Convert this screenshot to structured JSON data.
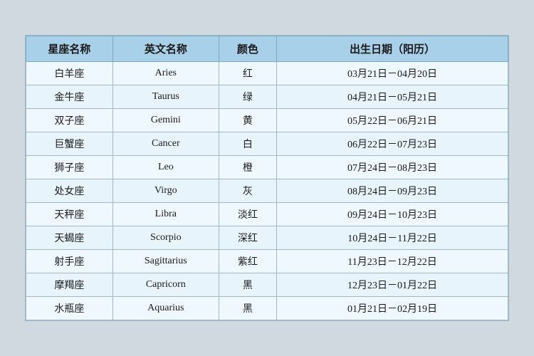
{
  "table": {
    "headers": [
      {
        "id": "col-chinese-name",
        "label": "星座名称"
      },
      {
        "id": "col-english-name",
        "label": "英文名称"
      },
      {
        "id": "col-color",
        "label": "颜色"
      },
      {
        "id": "col-birth-date",
        "label": "出生日期（阳历）"
      }
    ],
    "rows": [
      {
        "chinese": "白羊座",
        "english": "Aries",
        "color": "红",
        "date": "03月21日－04月20日"
      },
      {
        "chinese": "金牛座",
        "english": "Taurus",
        "color": "绿",
        "date": "04月21日－05月21日"
      },
      {
        "chinese": "双子座",
        "english": "Gemini",
        "color": "黄",
        "date": "05月22日－06月21日"
      },
      {
        "chinese": "巨蟹座",
        "english": "Cancer",
        "color": "白",
        "date": "06月22日－07月23日"
      },
      {
        "chinese": "狮子座",
        "english": "Leo",
        "color": "橙",
        "date": "07月24日－08月23日"
      },
      {
        "chinese": "处女座",
        "english": "Virgo",
        "color": "灰",
        "date": "08月24日－09月23日"
      },
      {
        "chinese": "天秤座",
        "english": "Libra",
        "color": "淡红",
        "date": "09月24日－10月23日"
      },
      {
        "chinese": "天蝎座",
        "english": "Scorpio",
        "color": "深红",
        "date": "10月24日－11月22日"
      },
      {
        "chinese": "射手座",
        "english": "Sagittarius",
        "color": "紫红",
        "date": "11月23日－12月22日"
      },
      {
        "chinese": "摩羯座",
        "english": "Capricorn",
        "color": "黑",
        "date": "12月23日－01月22日"
      },
      {
        "chinese": "水瓶座",
        "english": "Aquarius",
        "color": "黑",
        "date": "01月21日－02月19日"
      }
    ]
  }
}
